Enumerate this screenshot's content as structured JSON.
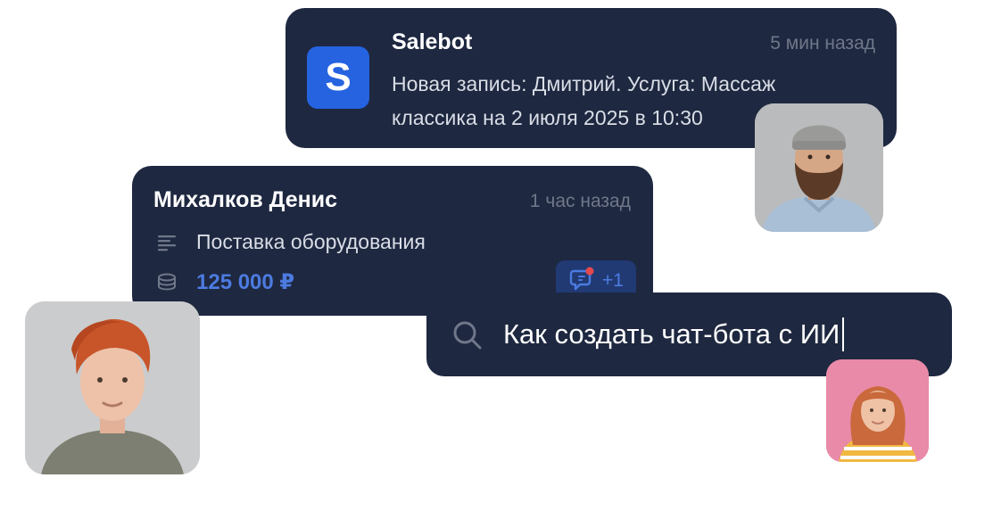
{
  "notification": {
    "title": "Salebot",
    "logo_letter": "S",
    "time": "5 мин назад",
    "text": "Новая запись: Дмитрий. Услуга: Массаж классика на 2 июля 2025 в 10:30",
    "logo_color": "#2563e0"
  },
  "deal": {
    "contact_name": "Михалков Денис",
    "time": "1 час назад",
    "description": "Поставка оборудования",
    "amount": "125 000 ₽",
    "comments_count": "+1",
    "description_icon": "text-lines-icon",
    "amount_icon": "coins-stack-icon",
    "comments_icon": "chat-bubble-icon",
    "accent_color": "#4c7be0"
  },
  "search": {
    "query": "Как создать чат-бота с ИИ",
    "icon": "search-icon"
  },
  "avatars": [
    {
      "name": "bearded-man-avatar"
    },
    {
      "name": "redhead-man-avatar"
    },
    {
      "name": "girl-avatar"
    }
  ],
  "colors": {
    "card_background": "#1e2840",
    "muted_text": "#6f7789",
    "notification_badge": "#e5484d"
  }
}
